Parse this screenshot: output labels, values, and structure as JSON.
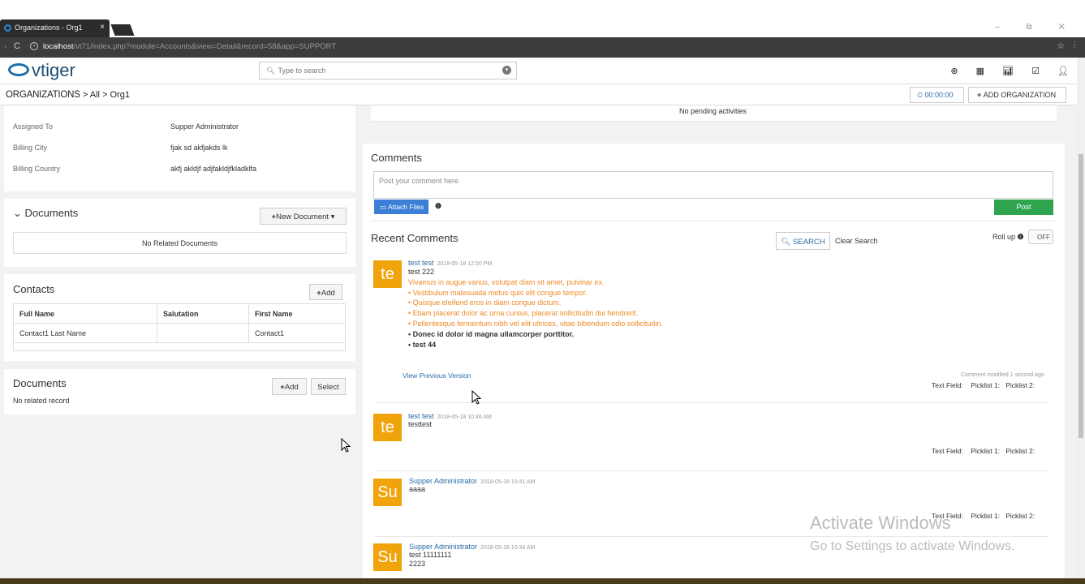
{
  "browser": {
    "tab_title": "Organizations - Org1",
    "tab_close": "×",
    "window_controls": "– ⧉ ✕",
    "url_host": "localhost",
    "url_path": "/vt71/index.php?module=Accounts&view=Detail&record=58&app=SUPPORT"
  },
  "header": {
    "logo_text": "vtiger",
    "search_placeholder": "Type to search"
  },
  "breadcrumb": {
    "module": "ORGANIZATIONS",
    "sep1": ">",
    "filter": "All",
    "sep2": ">",
    "record": "Org1"
  },
  "actions": {
    "timer": "00:00:00",
    "add_org": "ADD ORGANIZATION"
  },
  "details": {
    "fields": [
      {
        "label": "Assigned To",
        "value": "Supper Administrator"
      },
      {
        "label": "Billing City",
        "value": "fjak sd akfjakds lk"
      },
      {
        "label": "Billing Country",
        "value": "akfj akldjf adjfakldjfkladklfa"
      }
    ]
  },
  "documents_widget": {
    "title": "Documents",
    "new_button": "New Document",
    "empty": "No Related Documents"
  },
  "contacts": {
    "title": "Contacts",
    "add_button": "Add",
    "columns": [
      "Full Name",
      "Salutation",
      "First Name"
    ],
    "rows": [
      {
        "full_name": "Contact1 Last Name",
        "salutation": "",
        "first_name": "Contact1"
      }
    ]
  },
  "documents_related": {
    "title": "Documents",
    "add_button": "Add",
    "select_button": "Select",
    "empty": "No related record"
  },
  "activities": {
    "empty": "No pending activities"
  },
  "comments": {
    "title": "Comments",
    "placeholder": "Post your comment here",
    "attach_button": "Attach Files",
    "post_button": "Post",
    "recent_title": "Recent Comments",
    "search_button": "SEARCH",
    "clear_search": "Clear Search",
    "rollup_label": "Roll up",
    "rollup_state": "OFF",
    "items": [
      {
        "avatar": "te",
        "author": "test test",
        "time": "2018-05-18 12:50 PM",
        "lines": [
          "test 222"
        ],
        "orange_lines": [
          "Vivamus in augue varius, volutpat diam sit amet, pulvinar ex.",
          "Vestibulum malesuada metus quis elit congue tempor.",
          "Quisque eleifend eros in diam congue dictum.",
          "Etiam placerat dolor ac urna cursus, placerat sollicitudin dui hendrerit.",
          "Pellentesque fermentum nibh vel elit ultrices, vitae bibendum odio sollicitudin."
        ],
        "bold_lines": [
          "Donec id dolor id magna ullamcorper porttitor.",
          "test 44"
        ],
        "view_prev": "View Previous Version",
        "modified": "Comment modified 1 second ago"
      },
      {
        "avatar": "te",
        "author": "test test",
        "time": "2018-05-18 10:46 AM",
        "lines": [
          "testtest"
        ]
      },
      {
        "avatar": "Su",
        "author": "Supper Administrator",
        "time": "2018-05-18 10:41 AM",
        "lines": [
          "aaaa"
        ]
      },
      {
        "avatar": "Su",
        "author": "Supper Administrator",
        "time": "2018-05-18 10:34 AM",
        "lines": [
          "test 11111111",
          "2223"
        ]
      }
    ],
    "custom_fields": {
      "text_field": "Text Field:",
      "picklist1": "Picklist 1:",
      "picklist2": "Picklist 2:"
    }
  },
  "watermark": {
    "line1": "Activate Windows",
    "line2": "Go to Settings to activate Windows."
  },
  "colors": {
    "avatar": "#f0a30a",
    "link": "#2a6aa8",
    "post": "#2ea44f",
    "attach": "#3c7fd6"
  }
}
